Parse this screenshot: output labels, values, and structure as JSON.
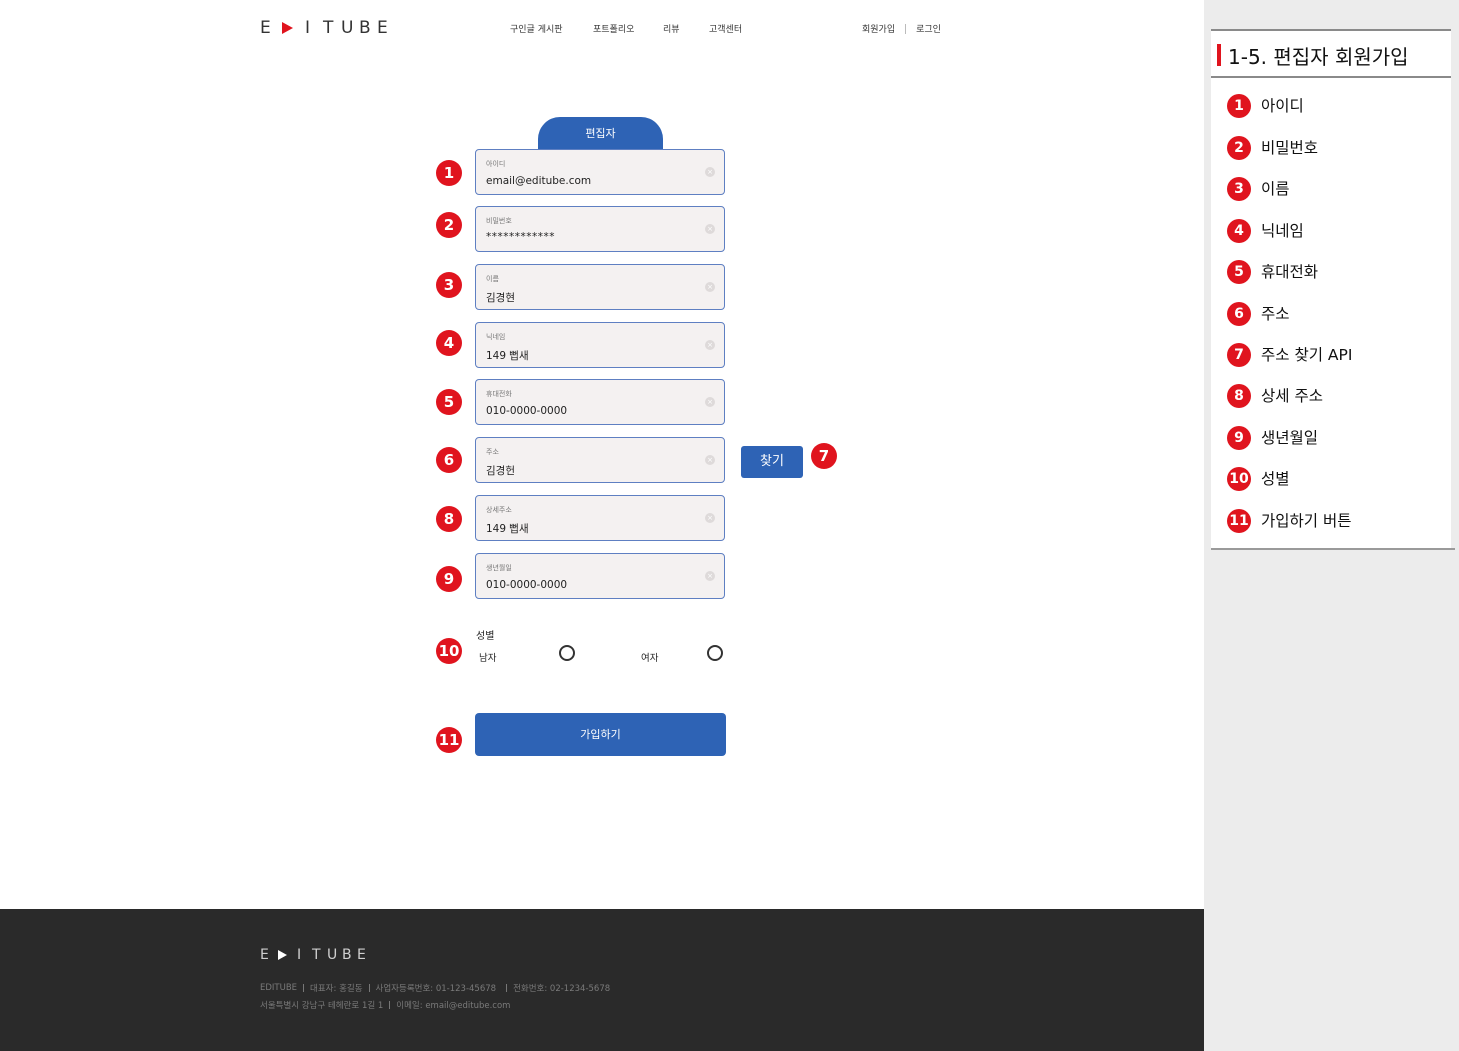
{
  "header": {
    "logo": {
      "letters_left": [
        "E"
      ],
      "letters_right": [
        "I",
        "T",
        "U",
        "B",
        "E"
      ]
    },
    "nav": [
      "구인글 게시판",
      "포트폴리오",
      "리뷰",
      "고객센터"
    ],
    "signup": "회원가입",
    "login": "로그인"
  },
  "form": {
    "role_tab": "편집자",
    "fields": [
      {
        "num": "1",
        "label": "아이디",
        "value": "email@editube.com"
      },
      {
        "num": "2",
        "label": "비밀번호",
        "value": "************"
      },
      {
        "num": "3",
        "label": "이름",
        "value": "김경현"
      },
      {
        "num": "4",
        "label": "닉네임",
        "value": "149 뻡새"
      },
      {
        "num": "5",
        "label": "휴대전화",
        "value": "010-0000-0000"
      },
      {
        "num": "6",
        "label": "주소",
        "value": "김경헌"
      },
      {
        "num": "8",
        "label": "상세주소",
        "value": "149 뻡새"
      },
      {
        "num": "9",
        "label": "생년월일",
        "value": "010-0000-0000"
      }
    ],
    "clear_icon": "×",
    "find_button": {
      "num": "7",
      "label": "찾기"
    },
    "gender": {
      "num": "10",
      "title": "성별",
      "male": "남자",
      "female": "여자"
    },
    "join_button": {
      "num": "11",
      "label": "가입하기"
    }
  },
  "footer": {
    "logo": {
      "letters_left": [
        "E"
      ],
      "letters_right": [
        "I",
        "T",
        "U",
        "B",
        "E"
      ]
    },
    "line1": [
      "EDITUBE",
      "대표자: 홍길동",
      "사업자등록번호: 01-123-45678",
      "전화번호: 02-1234-5678"
    ],
    "line2": [
      "서울특별시 강남구 테헤란로 1길 1",
      "이메일: email@editube.com"
    ]
  },
  "side_panel": {
    "title": "1-5. 편집자 회원가입",
    "items": [
      {
        "num": "1",
        "label": "아이디"
      },
      {
        "num": "2",
        "label": "비밀번호"
      },
      {
        "num": "3",
        "label": "이름"
      },
      {
        "num": "4",
        "label": "닉네임"
      },
      {
        "num": "5",
        "label": "휴대전화"
      },
      {
        "num": "6",
        "label": "주소"
      },
      {
        "num": "7",
        "label": "주소 찾기 API"
      },
      {
        "num": "8",
        "label": "상세 주소"
      },
      {
        "num": "9",
        "label": "생년월일"
      },
      {
        "num": "10",
        "label": "성별"
      },
      {
        "num": "11",
        "label": "가입하기 버튼"
      }
    ]
  },
  "colors": {
    "brand_red": "#e0141e",
    "primary_blue": "#2e63b5",
    "footer_bg": "#2a2a2a",
    "side_bg": "#ececec"
  }
}
